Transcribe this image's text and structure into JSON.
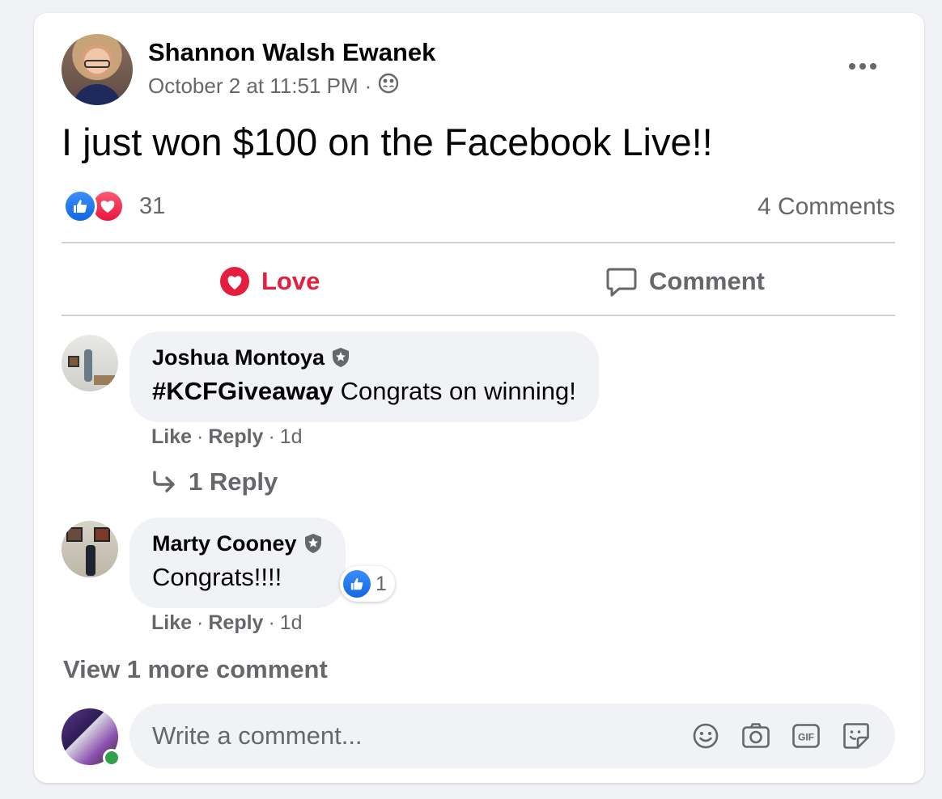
{
  "post": {
    "author": "Shannon Walsh Ewanek",
    "timestamp": "October 2 at 11:51 PM",
    "separator": "·",
    "audience_icon": "friends-icon",
    "text": "I just won $100 on the Facebook Live!!",
    "reaction_icons": [
      "like-icon",
      "love-icon"
    ],
    "reaction_count": "31",
    "comments_count": "4 Comments"
  },
  "actions": {
    "love_label": "Love",
    "comment_label": "Comment"
  },
  "comments": [
    {
      "author": "Joshua Montoya",
      "hashtag": "#KCFGiveaway",
      "text": " Congrats on winning!",
      "like_label": "Like",
      "reply_label": "Reply",
      "age": "1d",
      "replies_label": "1 Reply"
    },
    {
      "author": "Marty Cooney",
      "text": "Congrats!!!!",
      "like_label": "Like",
      "reply_label": "Reply",
      "age": "1d",
      "reaction_count": "1"
    }
  ],
  "view_more_label": "View 1 more comment",
  "composer": {
    "placeholder": "Write a comment...",
    "icons": [
      "emoji-icon",
      "camera-icon",
      "gif-icon",
      "sticker-icon"
    ]
  },
  "colors": {
    "love_red": "#e41e3f",
    "like_blue": "#1877f2",
    "secondary_text": "#65676b",
    "online_green": "#31a24c"
  }
}
